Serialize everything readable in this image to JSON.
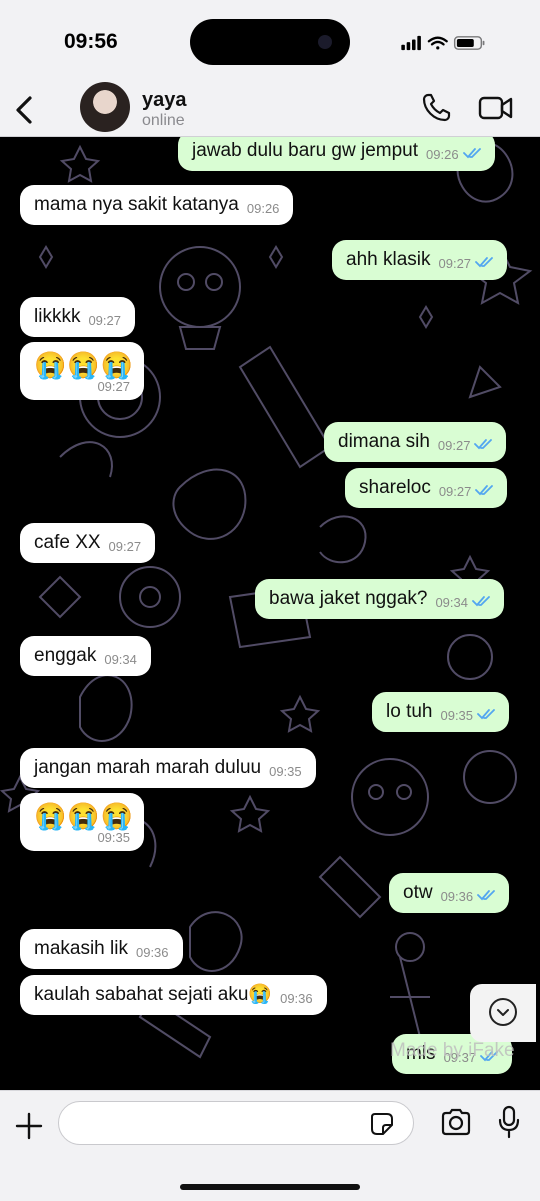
{
  "status_bar": {
    "time": "09:56",
    "icons": [
      "signal-icon",
      "wifi-icon",
      "battery-icon"
    ]
  },
  "header": {
    "contact_name": "yaya",
    "contact_status": "online",
    "icons": [
      "back-chevron-icon",
      "phone-icon",
      "video-camera-icon"
    ]
  },
  "messages": [
    {
      "direction": "out",
      "text": "jawab dulu baru gw jemput",
      "time": "09:26",
      "read": true
    },
    {
      "direction": "in",
      "text": "mama nya sakit katanya",
      "time": "09:26"
    },
    {
      "direction": "out",
      "text": "ahh klasik",
      "time": "09:27",
      "read": true
    },
    {
      "direction": "in",
      "text": "likkkk",
      "time": "09:27"
    },
    {
      "direction": "in",
      "text": "😭😭😭",
      "time": "09:27"
    },
    {
      "direction": "out",
      "text": "dimana sih",
      "time": "09:27",
      "read": true
    },
    {
      "direction": "out",
      "text": "shareloc",
      "time": "09:27",
      "read": true
    },
    {
      "direction": "in",
      "text": "cafe XX",
      "time": "09:27"
    },
    {
      "direction": "out",
      "text": "bawa jaket nggak?",
      "time": "09:34",
      "read": true
    },
    {
      "direction": "in",
      "text": "enggak",
      "time": "09:34"
    },
    {
      "direction": "out",
      "text": "lo tuh",
      "time": "09:35",
      "read": true
    },
    {
      "direction": "in",
      "text": "jangan marah marah duluu",
      "time": "09:35"
    },
    {
      "direction": "in",
      "text": "😭😭😭",
      "time": "09:35"
    },
    {
      "direction": "out",
      "text": "otw",
      "time": "09:36",
      "read": true
    },
    {
      "direction": "in",
      "text": "makasih lik",
      "time": "09:36"
    },
    {
      "direction": "in",
      "text": "kaulah sabahat sejati aku😭",
      "time": "09:36"
    },
    {
      "direction": "out",
      "text": "mls",
      "time": "09:37",
      "read": true
    }
  ],
  "watermark": "Made by iFake",
  "composer": {
    "placeholder": "",
    "icons": [
      "plus-icon",
      "sticker-icon",
      "camera-icon",
      "microphone-icon"
    ]
  },
  "colors": {
    "incoming_bubble": "#ffffff",
    "outgoing_bubble": "#d9fdd3",
    "read_ticks": "#53a6f0",
    "chat_background": "#000000",
    "wallpaper_doodles": "#5a5470"
  }
}
